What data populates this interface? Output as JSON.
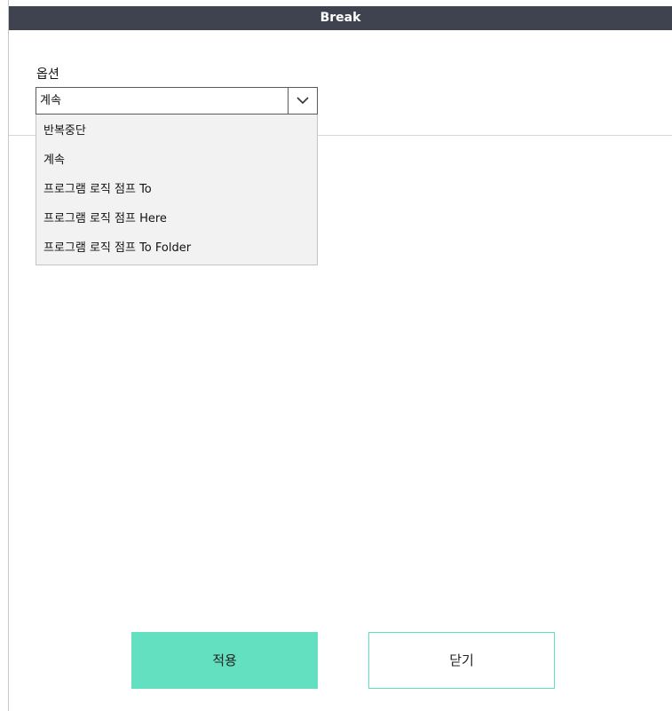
{
  "dialog": {
    "title": "Break"
  },
  "option_field": {
    "label": "옵션",
    "selected_value": "계속",
    "toggle_icon": "chevron-down-icon",
    "options": [
      "반복중단",
      "계속",
      "프로그램 로직 점프 To",
      "프로그램 로직 점프 Here",
      "프로그램 로직 점프 To Folder"
    ]
  },
  "actions": {
    "apply_label": "적용",
    "close_label": "닫기"
  },
  "colors": {
    "title_bar_background": "#3f4350",
    "accent": "#63e0c0",
    "dropdown_background": "#f2f2f2"
  }
}
